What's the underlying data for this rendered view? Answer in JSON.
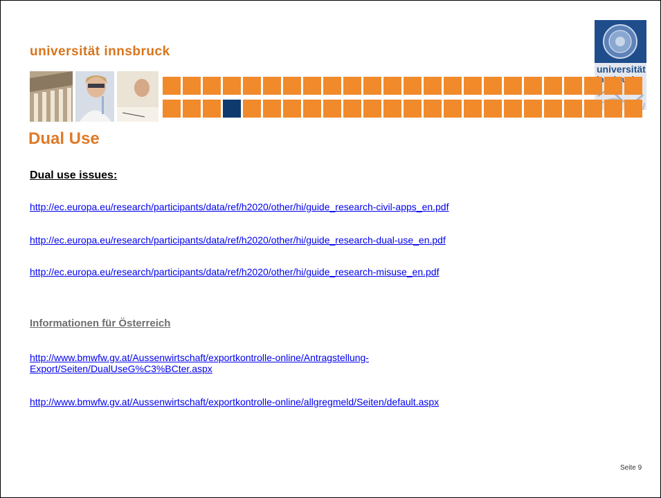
{
  "header": {
    "brand": "universität innsbruck"
  },
  "slide": {
    "title": "Dual Use",
    "page_label": "Seite 9"
  },
  "section1": {
    "heading": "Dual use issues:",
    "links": [
      "http://ec.europa.eu/research/participants/data/ref/h2020/other/hi/guide_research-civil-apps_en.pdf",
      "http://ec.europa.eu/research/participants/data/ref/h2020/other/hi/guide_research-dual-use_en.pdf",
      "http://ec.europa.eu/research/participants/data/ref/h2020/other/hi/guide_research-misuse_en.pdf"
    ]
  },
  "section2": {
    "heading": "Informationen für Österreich",
    "links": [
      "http://www.bmwfw.gv.at/Aussenwirtschaft/exportkontrolle-online/Antragstellung-Export/Seiten/DualUseG%C3%BCter.aspx",
      "http://www.bmwfw.gv.at/Aussenwirtschaft/exportkontrolle-online/allgregmeld/Seiten/default.aspx"
    ]
  },
  "colors": {
    "brand_orange": "#e07a27",
    "tile_orange": "#f08a2b",
    "tile_navy": "#0e3a6e",
    "link_blue": "#0000ee"
  }
}
